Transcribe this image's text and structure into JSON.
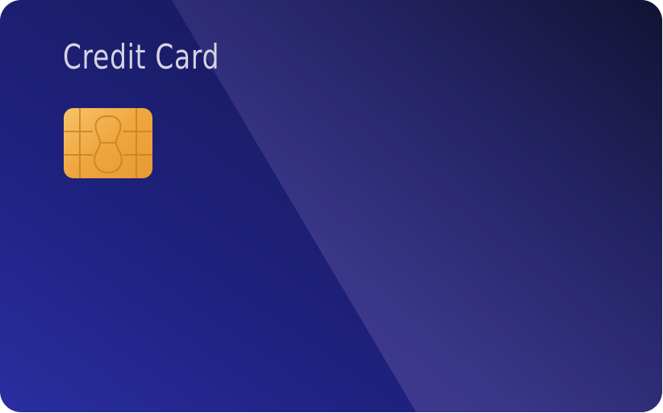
{
  "card": {
    "title": "Credit Card",
    "chip_icon": "emv-chip-icon",
    "colors": {
      "base_dark": "#14163f",
      "base_mid": "#1f2280",
      "base_light": "#2a2ea0",
      "shine": "#6a5bb8",
      "title_text": "#d7d3e3",
      "chip_gold": "#f2b04a"
    }
  }
}
